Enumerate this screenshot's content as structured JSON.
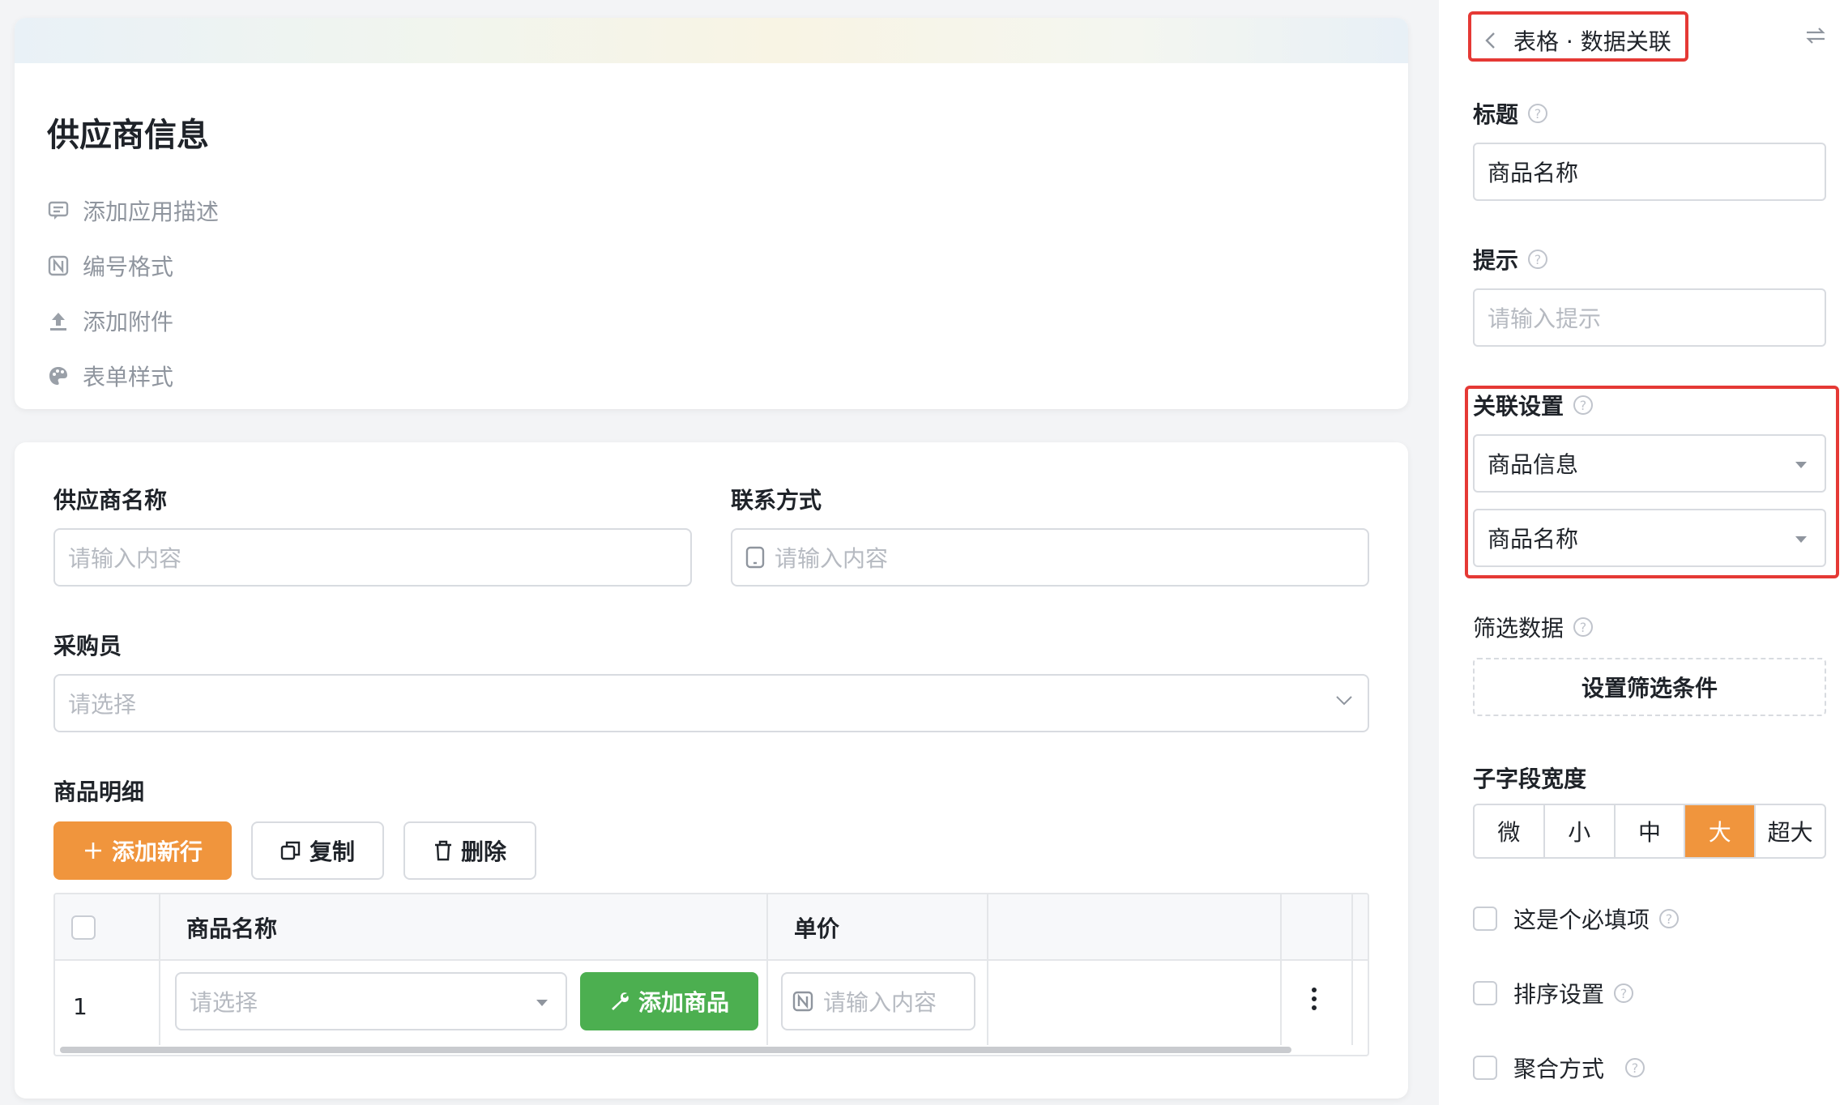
{
  "form": {
    "title": "供应商信息",
    "meta_items": [
      {
        "label": "添加应用描述",
        "icon": "comment-icon"
      },
      {
        "label": "编号格式",
        "icon": "number-format-icon"
      },
      {
        "label": "添加附件",
        "icon": "upload-icon"
      },
      {
        "label": "表单样式",
        "icon": "palette-icon"
      }
    ],
    "supplier_name": {
      "label": "供应商名称",
      "placeholder": "请输入内容"
    },
    "contact": {
      "label": "联系方式",
      "placeholder": "请输入内容"
    },
    "buyer": {
      "label": "采购员",
      "placeholder": "请选择"
    },
    "detail": {
      "label": "商品明细",
      "add_row": "添加新行",
      "copy": "复制",
      "delete": "删除",
      "columns": [
        "商品名称",
        "单价"
      ],
      "row": {
        "index": "1",
        "select_placeholder": "请选择",
        "add_product": "添加商品",
        "price_placeholder": "请输入内容"
      }
    }
  },
  "panel": {
    "breadcrumb": "表格 · 数据关联",
    "title_label": "标题",
    "title_value": "商品名称",
    "hint_label": "提示",
    "hint_placeholder": "请输入提示",
    "relation_label": "关联设置",
    "relation_form": "商品信息",
    "relation_field": "商品名称",
    "filter_label": "筛选数据",
    "filter_button": "设置筛选条件",
    "width_label": "子字段宽度",
    "width_options": [
      "微",
      "小",
      "中",
      "大",
      "超大"
    ],
    "width_selected": "大",
    "required_label": "这是个必填项",
    "sort_label": "排序设置",
    "aggregate_label": "聚合方式"
  },
  "colors": {
    "accent_orange": "#f0953d",
    "green": "#4caf50",
    "highlight_red": "#e53935"
  }
}
